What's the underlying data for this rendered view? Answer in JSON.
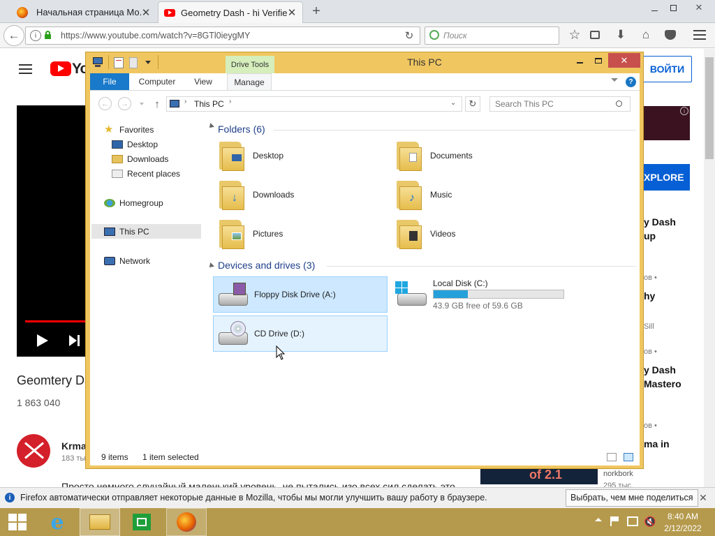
{
  "browser": {
    "tabs": [
      {
        "title": "Начальная страница Мо..."
      },
      {
        "title": "Geometry Dash - hi Verifie..."
      }
    ],
    "url": "https://www.youtube.com/watch?v=8GTl0ieygMY",
    "search_placeholder": "Поиск",
    "notice_text": "Firefox автоматически отправляет некоторые данные в Mozilla, чтобы мы могли улучшить вашу работу в браузере.",
    "notice_button": "Выбрать, чем мне поделиться"
  },
  "youtube": {
    "logo_text": "Yo",
    "signin": "ВОЙТИ",
    "explore": "XPLORE",
    "video_title": "Geomtery Da",
    "views": "1 863 040",
    "channel_name": "Krma",
    "channel_subs": "183 ты",
    "description": "Просто немного случайный маленький уровень, не пытались изо всех сил сделать это",
    "side": [
      {
        "title": "y Dash",
        "title2": "up",
        "meta": "ов •"
      },
      {
        "title": "hy",
        "meta": "Sill"
      },
      {
        "title": "y Dash",
        "title2": "Mastero",
        "meta": "ов •"
      },
      {
        "title": "ma in",
        "meta": "ов •"
      }
    ],
    "side_channel": "norkbork",
    "side_views": "295 тыс."
  },
  "explorer": {
    "title": "This PC",
    "drive_tools": "Drive Tools",
    "ribbon_tabs": [
      "File",
      "Computer",
      "View",
      "Manage"
    ],
    "breadcrumb": "This PC",
    "search_placeholder": "Search This PC",
    "nav": {
      "favorites": "Favorites",
      "desktop": "Desktop",
      "downloads": "Downloads",
      "recent": "Recent places",
      "homegroup": "Homegroup",
      "thispc": "This PC",
      "network": "Network"
    },
    "folders_header": "Folders (6)",
    "folders": [
      "Desktop",
      "Documents",
      "Downloads",
      "Music",
      "Pictures",
      "Videos"
    ],
    "drives_header": "Devices and drives (3)",
    "drives": {
      "floppy": "Floppy Disk Drive (A:)",
      "local": "Local Disk (C:)",
      "local_free": "43.9 GB free of 59.6 GB",
      "local_used_fraction": 0.263,
      "cd": "CD Drive (D:)"
    },
    "status_items": "9 items",
    "status_selected": "1 item selected"
  },
  "taskbar": {
    "time": "8:40 AM",
    "date": "2/12/2022"
  }
}
